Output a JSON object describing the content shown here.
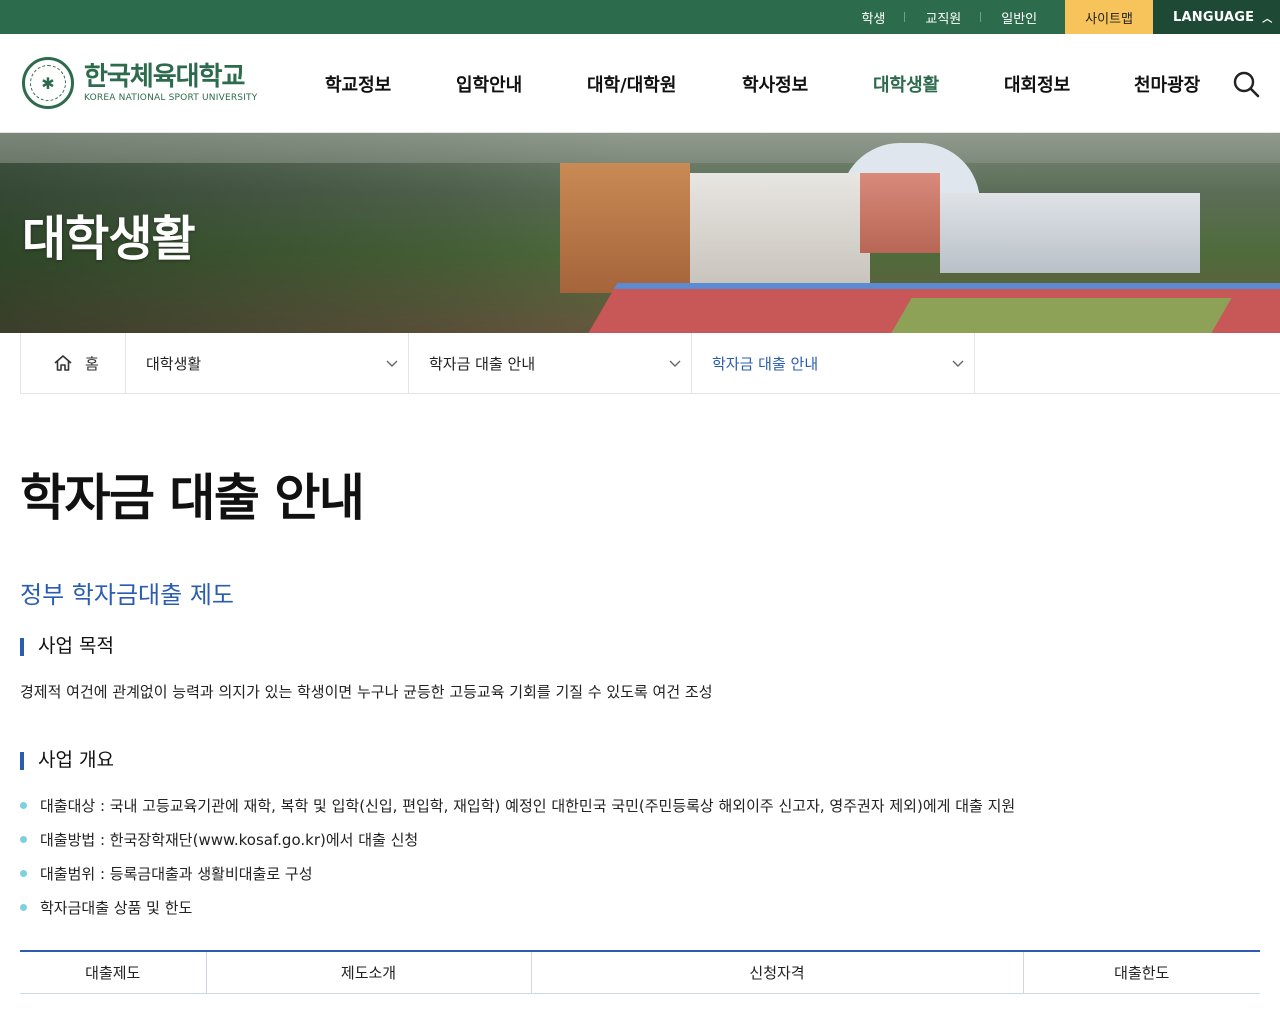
{
  "utility": {
    "links": [
      "학생",
      "교직원",
      "일반인"
    ],
    "sitemap": "사이트맵",
    "language": "LANGUAGE"
  },
  "logo": {
    "name_ko": "한국체육대학교",
    "name_en": "KOREA NATIONAL SPORT UNIVERSITY"
  },
  "nav": {
    "items": [
      "학교정보",
      "입학안내",
      "대학/대학원",
      "학사정보",
      "대학생활",
      "대회정보",
      "천마광장"
    ],
    "active": "대학생활"
  },
  "hero": {
    "title": "대학생활"
  },
  "breadcrumb": {
    "home": "홈",
    "level1": "대학생활",
    "level2": "학자금 대출 안내",
    "level3": "학자금 대출 안내"
  },
  "page": {
    "title": "학자금 대출 안내",
    "subtitle": "정부 학자금대출 제도",
    "section1": {
      "heading": "사업 목적",
      "text": "경제적 여건에 관계없이 능력과 의지가 있는 학생이면 누구나 균등한 고등교육 기회를 기질 수 있도록 여건 조성"
    },
    "section2": {
      "heading": "사업 개요",
      "bullets": [
        "대출대상 : 국내 고등교육기관에 재학, 복학 및 입학(신입, 편입학, 재입학) 예정인 대한민국 국민(주민등록상 해외이주 신고자, 영주권자 제외)에게 대출 지원",
        "대출방법 : 한국장학재단(www.kosaf.go.kr)에서 대출 신청",
        "대출범위 : 등록금대출과 생활비대출로 구성",
        "학자금대출 상품 및 한도"
      ]
    },
    "table": {
      "headers": [
        "대출제도",
        "제도소개",
        "신청자격",
        "대출한도"
      ]
    }
  },
  "colors": {
    "brand_green": "#2d6b4d",
    "accent_blue": "#2a5db0",
    "sitemap_yellow": "#f6c45b"
  }
}
